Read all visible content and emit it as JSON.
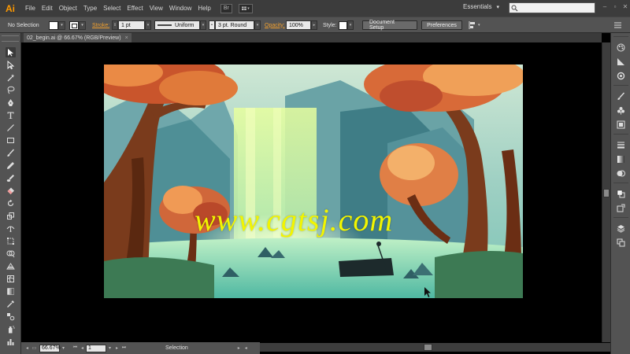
{
  "app": {
    "logo": "Ai",
    "menus": [
      "File",
      "Edit",
      "Object",
      "Type",
      "Select",
      "Effect",
      "View",
      "Window",
      "Help"
    ],
    "bridge_button": "Br",
    "workspace": "Essentials",
    "search_placeholder": ""
  },
  "control_bar": {
    "selection_status": "No Selection",
    "stroke_label": "Stroke:",
    "stroke_weight": "1 pt",
    "variable_width": "Uniform",
    "brush": "3 pt. Round",
    "opacity_label": "Opacity:",
    "opacity_value": "100%",
    "style_label": "Style:",
    "document_setup": "Document Setup",
    "preferences": "Preferences"
  },
  "document": {
    "tab_title": "02_begin.ai @ 66.67% (RGB/Preview)",
    "close": "×"
  },
  "status_bar": {
    "zoom": "66.67%",
    "artboard_number": "1",
    "tool_status": "Selection"
  },
  "watermark": "www.cgtsj.com",
  "colors": {
    "menubar": "#3c3c3c",
    "panel": "#535353",
    "accent": "#ff9a00",
    "watermark": "#f2f500"
  },
  "tools": [
    "selection-tool",
    "direct-selection-tool",
    "magic-wand-tool",
    "lasso-tool",
    "pen-tool",
    "type-tool",
    "line-segment-tool",
    "rectangle-tool",
    "paintbrush-tool",
    "pencil-tool",
    "blob-brush-tool",
    "eraser-tool",
    "rotate-tool",
    "scale-tool",
    "width-tool",
    "free-transform-tool",
    "shape-builder-tool",
    "perspective-grid-tool",
    "mesh-tool",
    "gradient-tool",
    "eyedropper-tool",
    "blend-tool",
    "symbol-sprayer-tool",
    "column-graph-tool",
    "artboard-tool",
    "slice-tool"
  ],
  "dock_panels": [
    "color-panel",
    "color-guide-panel",
    "appearance-panel",
    "brushes-panel",
    "symbols-panel",
    "graphic-styles-panel",
    "stroke-panel",
    "gradient-panel",
    "transparency-panel",
    "transform-panel",
    "layers-panel",
    "artboards-panel"
  ]
}
